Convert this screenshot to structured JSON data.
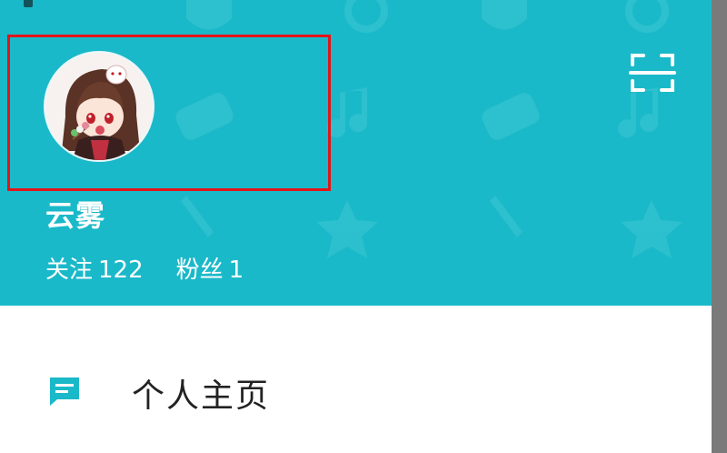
{
  "colors": {
    "header_background": "#1ab9c9",
    "highlight_border": "#e3141a",
    "menu_icon": "#1ab9c9",
    "scrim": "#7a7a7a"
  },
  "header": {
    "username": "云雾",
    "stats": [
      {
        "label": "关注",
        "value": "122"
      },
      {
        "label": "粉丝",
        "value": "1"
      }
    ],
    "scan_icon": "scan-icon",
    "avatar": "avatar-image"
  },
  "menu": {
    "items": [
      {
        "label": "个人主页",
        "icon": "message-square-icon"
      }
    ]
  }
}
